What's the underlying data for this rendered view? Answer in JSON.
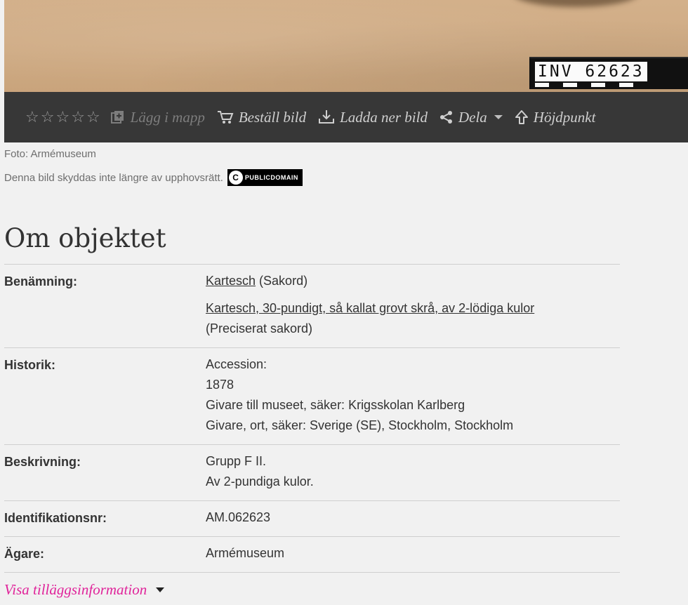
{
  "photo": {
    "inventory_label": "INV 62623"
  },
  "toolbar": {
    "stars": [
      "☆",
      "☆",
      "☆",
      "☆",
      "☆"
    ],
    "add_folder": "Lägg i mapp",
    "order_image": "Beställ bild",
    "download": "Ladda ner bild",
    "share": "Dela",
    "highlight": "Höjdpunkt"
  },
  "credits": {
    "photo": "Foto: Armémuseum",
    "copyright": "Denna bild skyddas inte längre av upphovsrätt.",
    "badge_symbol": "C",
    "badge_text": "PUBLICDOMAIN"
  },
  "section": {
    "title": "Om objektet"
  },
  "info": {
    "benamning": {
      "label": "Benämning:",
      "link1": "Kartesch",
      "suffix1": " (Sakord)",
      "link2": "Kartesch, 30-pundigt, så kallat grovt skrå, av 2-lödiga kulor",
      "suffix2": "(Preciserat sakord)"
    },
    "historik": {
      "label": "Historik:",
      "lines": [
        "Accession:",
        "1878",
        "Givare till museet, säker: Krigsskolan Karlberg",
        "Givare, ort, säker: Sverige (SE), Stockholm, Stockholm"
      ]
    },
    "beskrivning": {
      "label": "Beskrivning:",
      "lines": [
        "Grupp F II.",
        "Av 2-pundiga kulor."
      ]
    },
    "id": {
      "label": "Identifikationsnr:",
      "value": "AM.062623"
    },
    "agare": {
      "label": "Ägare:",
      "value": "Armémuseum"
    }
  },
  "more": {
    "label": "Visa tilläggsinformation"
  },
  "colors": {
    "toolbar_bg": "#373737",
    "accent_link": "#e0239a",
    "page_bg": "#f1f1f1"
  }
}
